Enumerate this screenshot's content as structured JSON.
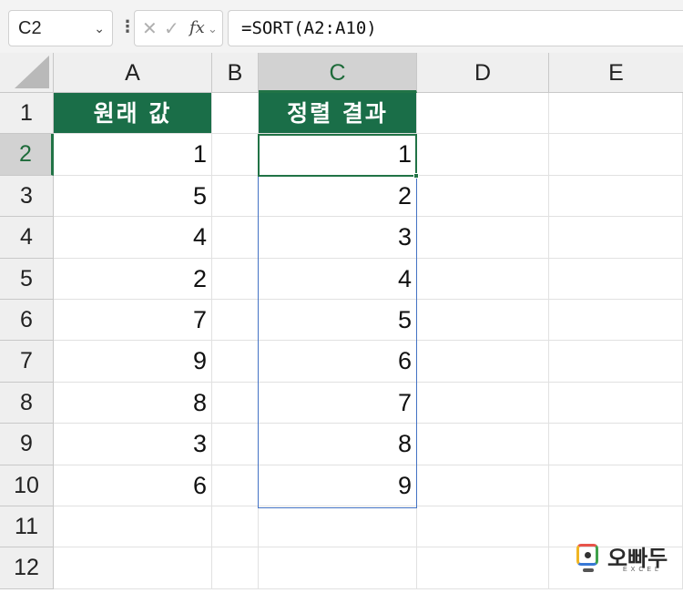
{
  "formula_bar": {
    "name_box": "C2",
    "formula": "=SORT(A2:A10)",
    "fx_label": "fx"
  },
  "columns": [
    "A",
    "B",
    "C",
    "D",
    "E"
  ],
  "selected_column": "C",
  "rows": [
    "1",
    "2",
    "3",
    "4",
    "5",
    "6",
    "7",
    "8",
    "9",
    "10",
    "11",
    "12"
  ],
  "selected_row": "2",
  "cells": {
    "A1": "원래 값",
    "C1": "정렬 결과",
    "A": [
      "1",
      "5",
      "4",
      "2",
      "7",
      "9",
      "8",
      "3",
      "6"
    ],
    "C": [
      "1",
      "2",
      "3",
      "4",
      "5",
      "6",
      "7",
      "8",
      "9"
    ]
  },
  "logo": {
    "text": "오빠두",
    "subtext": "EXCEL"
  },
  "colors": {
    "header_fill": "#1a6e48",
    "selection": "#217346",
    "spill_border": "#4472c4"
  }
}
